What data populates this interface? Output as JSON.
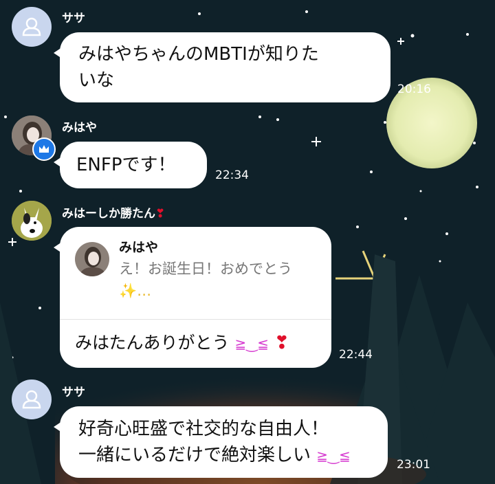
{
  "messages": [
    {
      "sender": "ササ",
      "avatar": "default-person-icon",
      "text_lines": [
        "みはやちゃんのMBTIが知りた",
        "いな"
      ],
      "time": "20:16"
    },
    {
      "sender": "みはや",
      "avatar": "user-photo-with-crown-badge",
      "text_lines": [
        "ENFPです！"
      ],
      "time": "22:34"
    },
    {
      "sender": "みはーしか勝たん",
      "sender_emoji": "❣",
      "avatar": "dog-avatar",
      "reply": {
        "name": "みはや",
        "text_lines": [
          "え！お誕生日！おめでとう",
          "✨…"
        ]
      },
      "text": "みはたんありがとう",
      "text_emoji": "❣",
      "time": "22:44"
    },
    {
      "sender": "ササ",
      "avatar": "default-person-icon",
      "text_lines": [
        "好奇心旺盛で社交的な自由人！",
        "一緒にいるだけで絶対楽しい"
      ],
      "time": "23:01"
    }
  ],
  "colors": {
    "bubble": "#ffffff",
    "crown_badge": "#1e78e6",
    "heart": "#e0102b"
  }
}
